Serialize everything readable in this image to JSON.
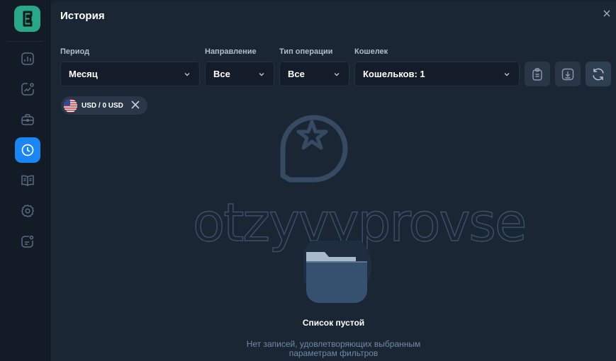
{
  "app": {
    "logo_letter": "E",
    "brand_color": "#2aa787",
    "accent_color": "#1a86f4"
  },
  "sidebar": {
    "items": [
      {
        "icon": "chart-icon",
        "active": false
      },
      {
        "icon": "analytics-icon",
        "active": false
      },
      {
        "icon": "briefcase-icon",
        "active": false
      },
      {
        "icon": "clock-icon",
        "active": true
      },
      {
        "icon": "book-icon",
        "active": false
      },
      {
        "icon": "gear-icon",
        "active": false
      },
      {
        "icon": "notes-icon",
        "active": false
      }
    ]
  },
  "header": {
    "title": "История",
    "close_icon": "close-icon"
  },
  "filters": {
    "period": {
      "label": "Период",
      "value": "Месяц"
    },
    "direction": {
      "label": "Направление",
      "value": "Все"
    },
    "operation_type": {
      "label": "Тип операции",
      "value": "Все"
    },
    "wallet": {
      "label": "Кошелек",
      "value": "Кошельков: 1"
    }
  },
  "toolbar": {
    "icons": [
      "clipboard-icon",
      "download-icon",
      "refresh-icon"
    ]
  },
  "chips": [
    {
      "label": "USD / 0 USD",
      "icon": "us-flag-icon"
    }
  ],
  "watermark": {
    "text": "otzyvyprovse"
  },
  "empty_state": {
    "title": "Список пустой",
    "description": "Нет записей, удовлетворяющих выбранным параметрам фильтров"
  }
}
